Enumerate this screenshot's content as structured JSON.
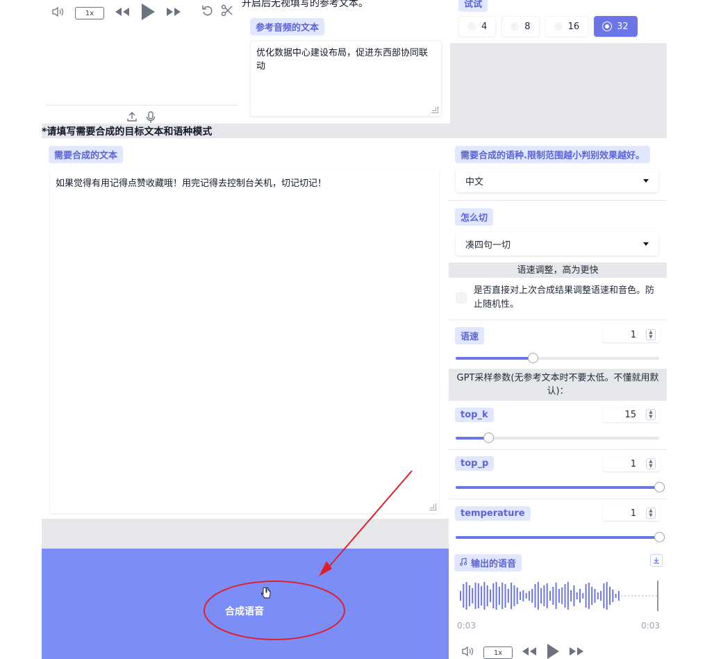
{
  "top_audio": {
    "rate": "1x"
  },
  "reference": {
    "note": "开启后无视填写的参考文本。",
    "label": "参考音频的文本",
    "text": "优化数据中心建设布局，促进东西部协同联动"
  },
  "top_right": {
    "label": "试试",
    "options": [
      "4",
      "8",
      "16",
      "32"
    ],
    "selected": "32"
  },
  "section_title": "*请填写需要合成的目标文本和语种模式",
  "target": {
    "label": "需要合成的文本",
    "text": "如果觉得有用记得点赞收藏哦！用完记得去控制台关机，切记切记！"
  },
  "settings": {
    "language_label": "需要合成的语种.限制范围越小判别效果越好。",
    "language_value": "中文",
    "split_label": "怎么切",
    "split_value": "凑四句一切",
    "speed_header": "语速调整，高为更快",
    "checkbox_text": "是否直接对上次合成结果调整语速和音色。防止随机性。",
    "speed_label": "语速",
    "speed_value": "1",
    "speed_fraction": 0.38,
    "gpt_header": "GPT采样参数(无参考文本时不要太低。不懂就用默认)：",
    "top_k_label": "top_k",
    "top_k_value": "15",
    "top_k_fraction": 0.16,
    "top_p_label": "top_p",
    "top_p_value": "1",
    "top_p_fraction": 1.0,
    "temperature_label": "temperature",
    "temperature_value": "1",
    "temperature_fraction": 1.0
  },
  "generate_button": "合成语音",
  "output": {
    "label": "输出的语音",
    "time_current": "0:03",
    "time_total": "0:03",
    "rate": "1x"
  },
  "colors": {
    "accent": "#6b75e8",
    "button": "#7b8ef7",
    "annotation": "#e11d2a"
  }
}
